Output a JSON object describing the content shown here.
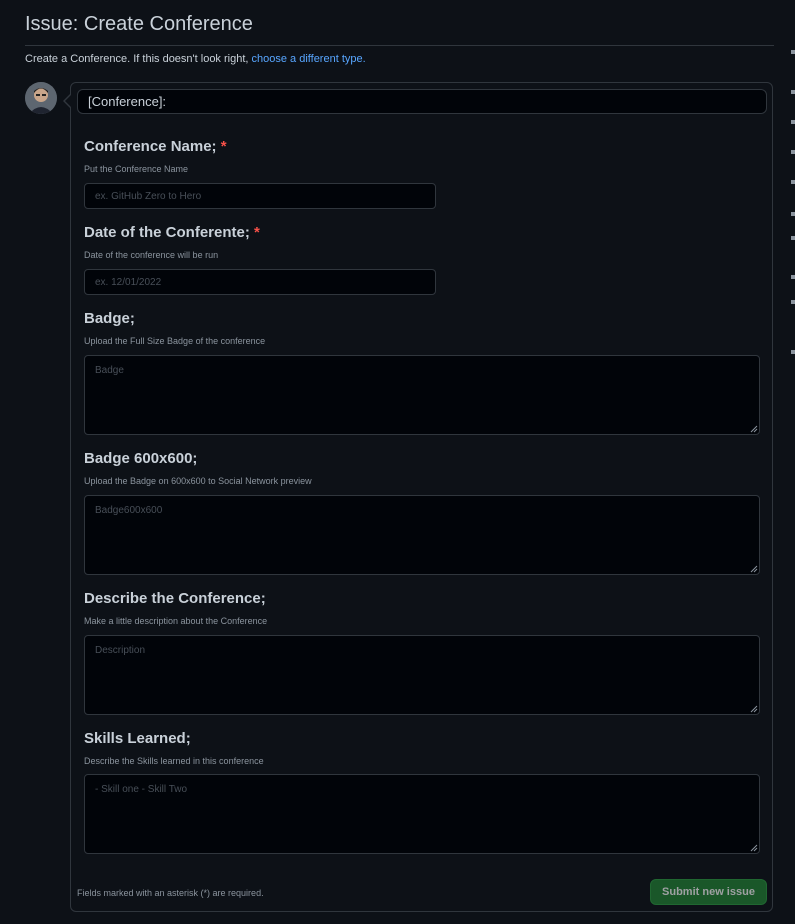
{
  "page": {
    "title": "Issue: Create Conference",
    "subtitle_text": "Create a Conference. If this doesn't look right,",
    "subtitle_link": "choose a different type."
  },
  "issue": {
    "title_value": "[Conference]:"
  },
  "fields": [
    {
      "label": "Conference Name;",
      "required_mark": "*",
      "description": "Put the Conference Name",
      "placeholder": "ex. GitHub Zero to Hero"
    },
    {
      "label": "Date of the Conferente;",
      "required_mark": "*",
      "description": "Date of the conference will be run",
      "placeholder": "ex. 12/01/2022"
    },
    {
      "label": "Badge;",
      "description": "Upload the Full Size Badge of the conference",
      "placeholder": "Badge"
    },
    {
      "label": "Badge 600x600;",
      "description": "Upload the Badge on 600x600 to Social Network preview",
      "placeholder": "Badge600x600"
    },
    {
      "label": "Describe the Conference;",
      "description": "Make a little description about the Conference",
      "placeholder": "Description"
    },
    {
      "label": "Skills Learned;",
      "description": "Describe the Skills learned in this conference",
      "placeholder": "- Skill one - Skill Two"
    }
  ],
  "footer": {
    "required_note": "Fields marked with an asterisk (*) are required.",
    "submit_label": "Submit new issue"
  },
  "colors": {
    "background": "#0d1117",
    "link": "#58a6ff",
    "required": "#f85149",
    "submit": "#238636"
  }
}
